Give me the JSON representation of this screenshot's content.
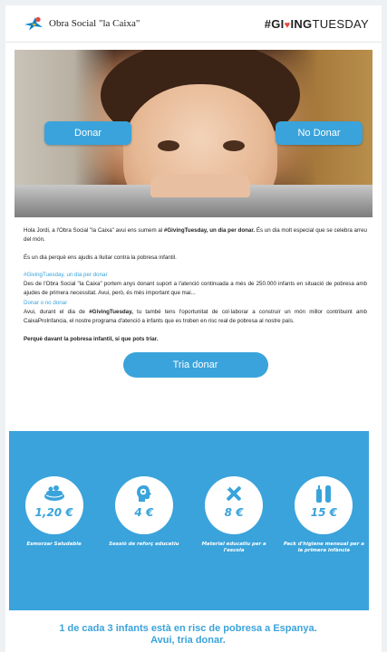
{
  "header": {
    "logo_text": "Obra Social \"la Caixa\"",
    "tag_part1": "#GI",
    "tag_heart": "♥",
    "tag_part2": "ING",
    "tag_part3": "TUESDAY"
  },
  "hero": {
    "donar_label": "Donar",
    "no_donar_label": "No Donar"
  },
  "body": {
    "p1_a": "Hola Jordi, a l'Obra Social \"la Caixa\" avui ens sumem al ",
    "p1_b": "#GivingTuesday, un dia per donar.",
    "p1_c": " És un dia molt especial que se celebra arreu del món.",
    "p2": "És un dia perquè ens ajudis a lluitar contra la pobresa infantil.",
    "p3_link": "#GivingTuesday, un dia per donar",
    "p3_text": "Des de l'Obra Social \"la Caixa\" portem anys donant suport a l'atenció continuada a més de 250.000 infants en situació de pobresa amb ajudes de primera necessitat. Avui, però, és més important que mai...",
    "p4_link": "Donar o no donar",
    "p4_a": "Avui, durant el dia de ",
    "p4_b": "#GivingTuesday,",
    "p4_c": " tu també tens l'oportunitat de col·laborar a construir un món millor contribuint amb CaixaProInfancia, el nostre programa d'atenció a infants que es troben en risc real de pobresa al nostre país.",
    "p5": "Perquè davant la pobresa infantil, sí que pots triar.",
    "cta_label": "Tria donar"
  },
  "donations": [
    {
      "icon": "lunchbox-icon",
      "price": "1,20 €",
      "caption": "Esmorzar Saludable"
    },
    {
      "icon": "head-gear-icon",
      "price": "4 €",
      "caption": "Sessió de reforç educatiu"
    },
    {
      "icon": "tools-icon",
      "price": "8 €",
      "caption": "Material educatiu per a l'escola"
    },
    {
      "icon": "hygiene-icon",
      "price": "15 €",
      "caption": "Pack d'higiene mensual per a la primera infància"
    }
  ],
  "footer": {
    "line1": "1 de cada 3 infants està en risc de pobresa a Espanya.",
    "line2": "Avui, tria donar."
  },
  "colors": {
    "accent": "#3aa3db",
    "white": "#ffffff",
    "heart": "#e8483d"
  }
}
